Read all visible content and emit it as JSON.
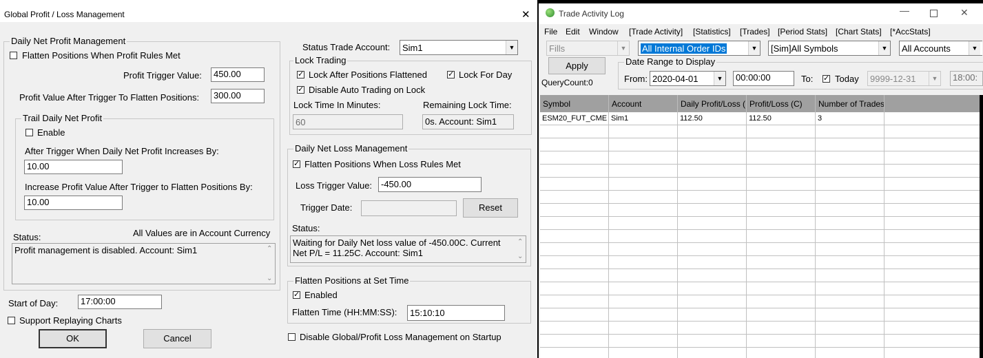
{
  "left_window": {
    "title": "Global Profit / Loss Management",
    "close_glyph": "✕",
    "profit": {
      "group_title": "Daily Net Profit Management",
      "flatten_label": "Flatten Positions When Profit Rules Met",
      "trigger_label": "Profit Trigger Value:",
      "trigger_value": "450.00",
      "after_label": "Profit Value After Trigger To Flatten Positions:",
      "after_value": "300.00",
      "trail_title": "Trail Daily Net Profit",
      "enable_label": "Enable",
      "increase_label": "After Trigger When Daily Net Profit Increases By:",
      "increase_value": "10.00",
      "increase_flatten_label": "Increase Profit Value After Trigger to Flatten Positions By:",
      "increase_flatten_value": "10.00",
      "status_label": "Status:",
      "currency_note": "All Values are in Account Currency",
      "status_text": "Profit management is disabled. Account: Sim1"
    },
    "start_of_day_label": "Start of Day:",
    "start_of_day_value": "17:00:00",
    "replay_label": "Support Replaying Charts",
    "ok_label": "OK",
    "cancel_label": "Cancel",
    "status_account_label": "Status Trade Account:",
    "status_account_value": "Sim1",
    "lock": {
      "group_title": "Lock Trading",
      "after_flatten_label": "Lock After Positions Flattened",
      "for_day_label": "Lock For Day",
      "disable_auto_label": "Disable Auto Trading on Lock",
      "minutes_label": "Lock Time In Minutes:",
      "minutes_value": "60",
      "remaining_label": "Remaining Lock Time:",
      "remaining_value": "0s. Account: Sim1"
    },
    "loss": {
      "group_title": "Daily Net Loss Management",
      "flatten_label": "Flatten Positions When Loss Rules Met",
      "trigger_label": "Loss Trigger Value:",
      "trigger_value": "-450.00",
      "date_label": "Trigger Date:",
      "date_value": "",
      "reset_label": "Reset",
      "status_label": "Status:",
      "status_text": "Waiting for Daily Net loss value of -450.00C.  Current Net P/L = 11.25C.  Account: Sim1"
    },
    "flatten_time": {
      "group_title": "Flatten Positions at Set Time",
      "enabled_label": "Enabled",
      "time_label": "Flatten Time (HH:MM:SS):",
      "time_value": "15:10:10"
    },
    "disable_startup_label": "Disable Global/Profit Loss Management on Startup"
  },
  "right_window": {
    "title": "Trade Activity Log",
    "menu": [
      "File",
      "Edit",
      "Window",
      "[Trade Activity]",
      "[Statistics]",
      "[Trades]",
      "[Period Stats]",
      "[Chart Stats]",
      "[*AccStats]"
    ],
    "fills_value": "Fills",
    "order_ids_value": "All Internal Order IDs",
    "symbols_value": "[Sim]All Symbols",
    "accounts_value": "All Accounts",
    "apply_label": "Apply",
    "query_count": "QueryCount:0",
    "date_range_title": "Date Range to Display",
    "from_label": "From:",
    "from_date": "2020-04-01",
    "from_time": "00:00:00",
    "to_label": "To:",
    "today_label": "Today",
    "to_date": "9999-12-31",
    "to_time": "18:00:",
    "columns": [
      "Symbol",
      "Account",
      "Daily Profit/Loss (",
      "Profit/Loss (C)",
      "Number of Trades"
    ],
    "rows": [
      [
        "ESM20_FUT_CME",
        "Sim1",
        "112.50",
        "112.50",
        "3"
      ]
    ]
  },
  "colors": {
    "selected_highlight": "#0078d7",
    "grid_header": "#a0a0a0",
    "dialog_bg": "#f0f0f0"
  }
}
